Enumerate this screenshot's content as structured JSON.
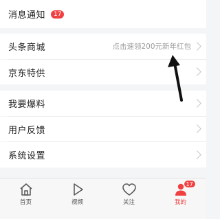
{
  "menu": {
    "notifications": {
      "label": "消息通知",
      "badge": "17"
    },
    "mall": {
      "label": "头条商城",
      "hint": "点击速领200元新年红包"
    },
    "jd": {
      "label": "京东特供"
    },
    "report": {
      "label": "我要爆料"
    },
    "feedback": {
      "label": "用户反馈"
    },
    "settings": {
      "label": "系统设置"
    }
  },
  "tabbar": {
    "home": "首页",
    "video": "视频",
    "follow": "关注",
    "mine": "我的",
    "mine_badge": "17"
  },
  "colors": {
    "accent": "#f04142",
    "background": "#f4f5f6"
  },
  "annotation": {
    "type": "arrow-icon",
    "points_to": "mall.hint"
  }
}
